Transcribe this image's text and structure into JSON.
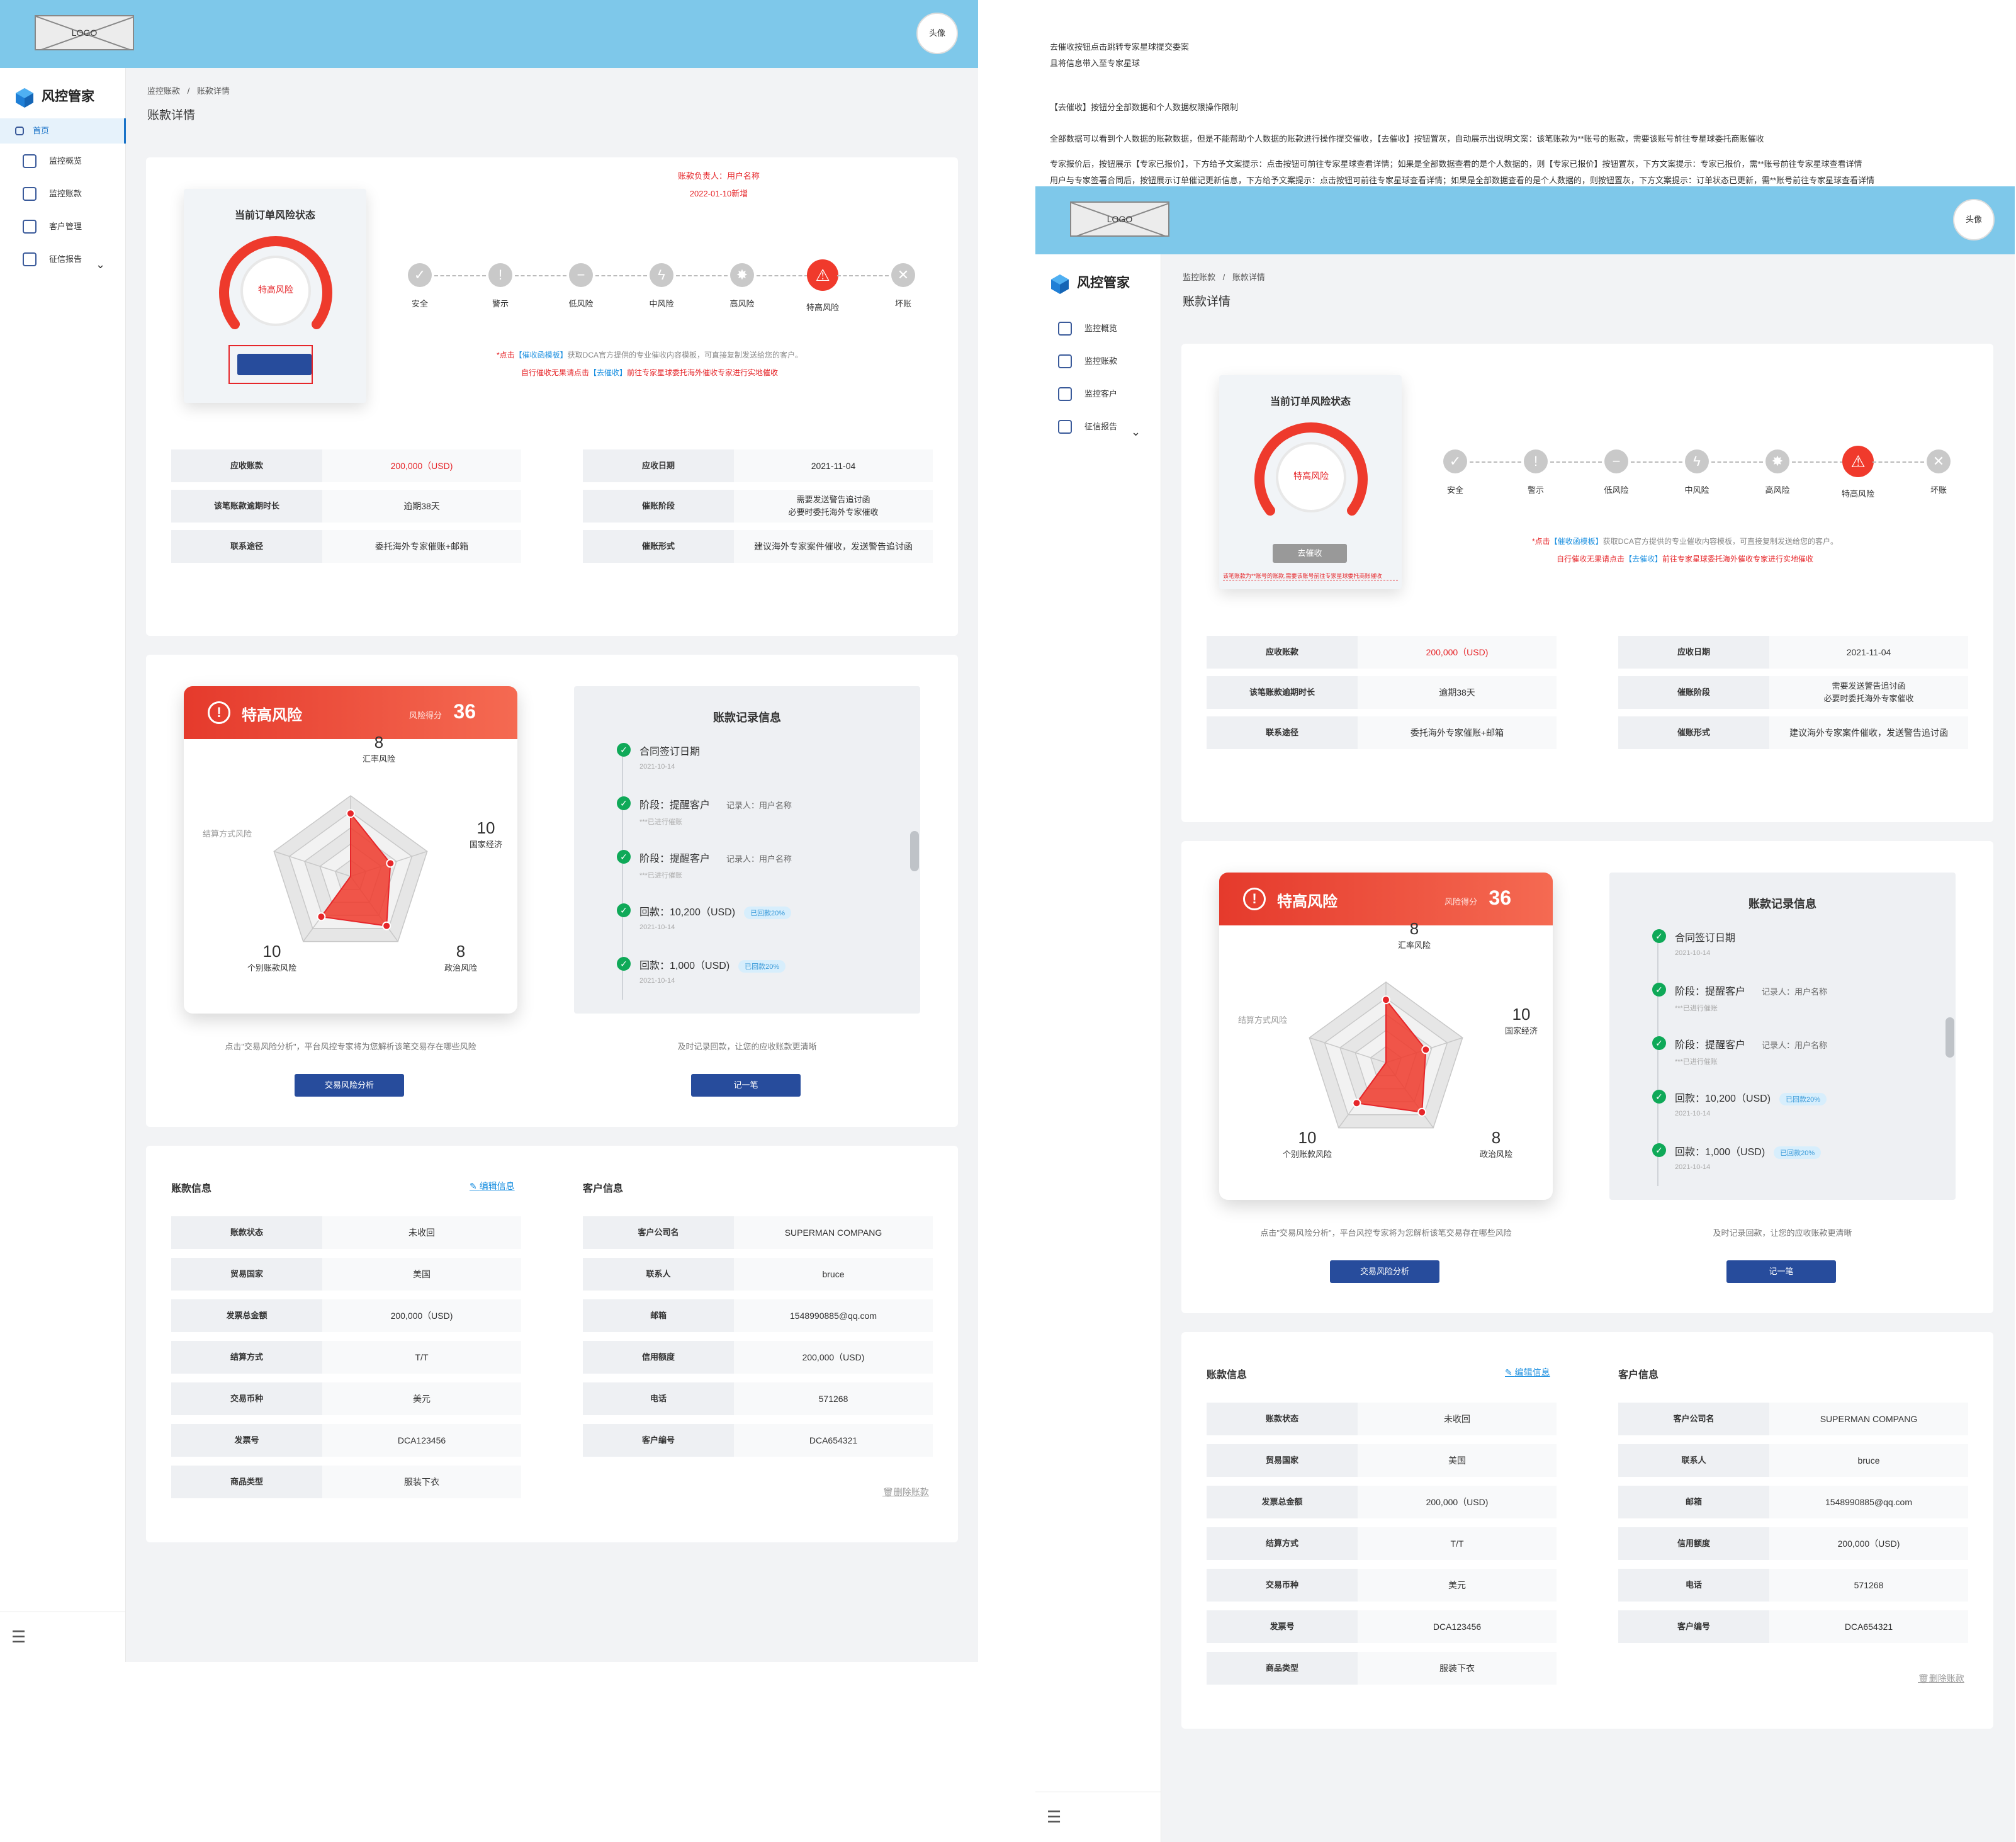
{
  "notes": {
    "line1": "去催收按钮点击跳转专家星球提交委案",
    "line2": "且将信息带入至专家星球",
    "line3": "【去催收】按钮分全部数据和个人数据权限操作限制",
    "line4": "全部数据可以看到个人数据的账款数据，但是不能帮助个人数据的账款进行操作提交催收，【去催收】按钮置灰，自动展示出说明文案：该笔账款为**账号的账款，需要该账号前往专星球委托商账催收",
    "line5": "专家报价后，按钮展示【专家已报价】，下方给予文案提示：点击按钮可前往专家星球查看详情；如果是全部数据查看的是个人数据的，则【专家已报价】按钮置灰，下方文案提示：专家已报价，需**账号前往专家星球查看详情",
    "line6": "用户与专家签署合同后，按钮展示订单催记更新信息，下方给予文案提示：点击按钮可前往专家星球查看详情；如果是全部数据查看的是个人数据的，则按钮置灰，下方文案提示：订单状态已更新，需**账号前往专家星球查看详情"
  },
  "app": {
    "logo": "LOGO",
    "avatar": "头像",
    "brand": "风控管家"
  },
  "nav": {
    "home": "首页",
    "overview": "监控概览",
    "accounts": "监控账款",
    "customers": "客户管理",
    "customers_b": "监控客户",
    "credit": "征信报告"
  },
  "breadcrumb": {
    "l1": "监控账款",
    "sep": "/",
    "l2": "账款详情"
  },
  "page_title": "账款详情",
  "state": {
    "card_title": "当前订单风险状态",
    "gauge_label": "特高风险",
    "button_b": "去催收",
    "owner": "账款负责人：用户名称",
    "created": "2022-01-10新增",
    "disabled_note": "该笔账款为**账号的账款,需要该账号前往专家星球委托商账催收",
    "steps": [
      "安全",
      "警示",
      "低风险",
      "中风险",
      "高风险",
      "特高风险",
      "坏账"
    ],
    "note1a": "*点击",
    "note1b": "【催收函模板】",
    "note1c": "获取DCA官方提供的专业催收内容模板，可直接复制发送给您的客户。",
    "note2a": "自行催收无果请点击",
    "note2b": "【去催收】",
    "note2c": "前往专家星球委托海外催收专家进行实地催收"
  },
  "summary": {
    "left": [
      {
        "k": "应收账款",
        "v": "200,000（USD)"
      },
      {
        "k": "该笔账款逾期时长",
        "v": "逾期38天"
      },
      {
        "k": "联系途径",
        "v": "委托海外专家催账+邮箱"
      }
    ],
    "right": [
      {
        "k": "应收日期",
        "v": "2021-11-04"
      },
      {
        "k": "催账阶段",
        "v1": "需要发送警告追讨函",
        "v2": "必要时委托海外专家催收"
      },
      {
        "k": "催账形式",
        "v": "建议海外专家案件催收，发送警告追讨函"
      }
    ]
  },
  "risk": {
    "title": "特高风险",
    "score_label": "风险得分",
    "score": "36",
    "axes": [
      {
        "name": "汇率风险",
        "value": "8"
      },
      {
        "name": "国家经济",
        "value": "10"
      },
      {
        "name": "政治风险",
        "value": "8"
      },
      {
        "name": "个别账款风险",
        "value": "10"
      },
      {
        "name": "结算方式风险",
        "value": ""
      }
    ],
    "hint": "点击\"交易风险分析\"，平台风控专家将为您解析该笔交易存在哪些风险",
    "button": "交易风险分析"
  },
  "records": {
    "title": "账款记录信息",
    "items": [
      {
        "title": "合同签订日期",
        "sub": "2021-10-14",
        "rec": "",
        "tag": ""
      },
      {
        "title": "阶段：提醒客户",
        "sub": "***已进行催账",
        "rec": "记录人：用户名称",
        "tag": ""
      },
      {
        "title": "阶段：提醒客户",
        "sub": "***已进行催账",
        "rec": "记录人：用户名称",
        "tag": ""
      },
      {
        "title": "回款：10,200（USD)",
        "sub": "2021-10-14",
        "rec": "",
        "tag": "已回款20%"
      },
      {
        "title": "回款：1,000（USD)",
        "sub": "2021-10-14",
        "rec": "",
        "tag": "已回款20%"
      }
    ],
    "hint": "及时记录回款，让您的应收账款更清晰",
    "button": "记一笔"
  },
  "account_info": {
    "title": "账款信息",
    "edit": "编辑信息",
    "rows": [
      {
        "k": "账款状态",
        "v": "未收回"
      },
      {
        "k": "贸易国家",
        "v": "美国"
      },
      {
        "k": "发票总金额",
        "v": "200,000（USD)"
      },
      {
        "k": "结算方式",
        "v": "T/T"
      },
      {
        "k": "交易币种",
        "v": "美元"
      },
      {
        "k": "发票号",
        "v": "DCA123456"
      },
      {
        "k": "商品类型",
        "v": "服装下衣"
      }
    ]
  },
  "customer_info": {
    "title": "客户信息",
    "rows": [
      {
        "k": "客户公司名",
        "v": "SUPERMAN COMPANG"
      },
      {
        "k": "联系人",
        "v": "bruce"
      },
      {
        "k": "邮箱",
        "v": "1548990885@qq.com"
      },
      {
        "k": "信用额度",
        "v": "200,000（USD)"
      },
      {
        "k": "电话",
        "v": "571268"
      },
      {
        "k": "客户编号",
        "v": "DCA654321"
      }
    ],
    "delete": "删除账款"
  },
  "colors": {
    "accent": "#274c9c",
    "danger": "#e6262a",
    "topbar": "#7ec8ea",
    "success": "#0fa958"
  }
}
